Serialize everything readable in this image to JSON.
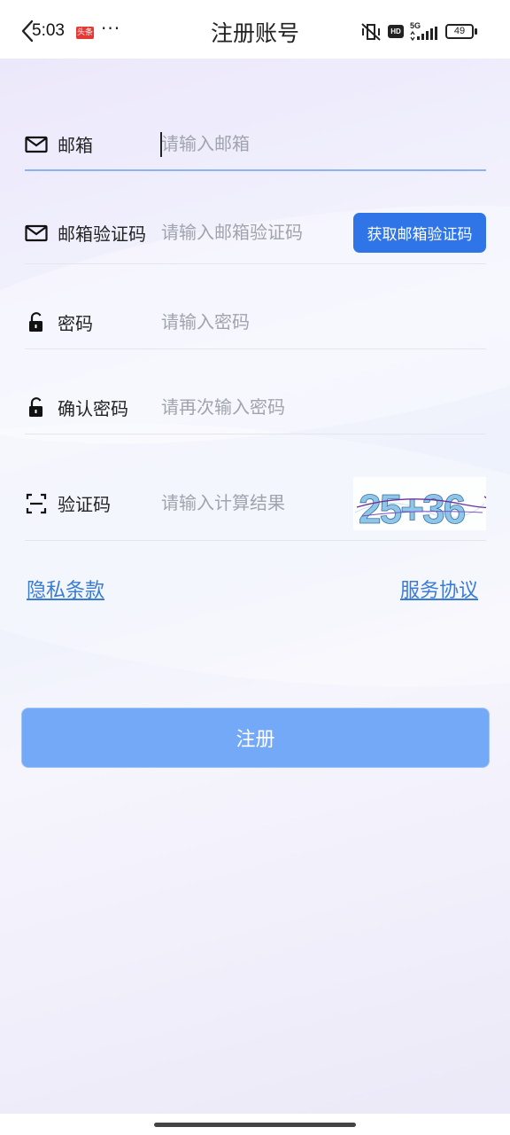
{
  "status_bar": {
    "time": "5:03",
    "app_badge": "头条",
    "more": "···",
    "network": "5G",
    "hd": "HD",
    "battery": "49"
  },
  "header": {
    "title": "注册账号"
  },
  "form": {
    "email": {
      "label": "邮箱",
      "placeholder": "请输入邮箱"
    },
    "email_code": {
      "label": "邮箱验证码",
      "placeholder": "请输入邮箱验证码",
      "button": "获取邮箱验证码"
    },
    "password": {
      "label": "密码",
      "placeholder": "请输入密码"
    },
    "confirm_password": {
      "label": "确认密码",
      "placeholder": "请再次输入密码"
    },
    "captcha": {
      "label": "验证码",
      "placeholder": "请输入计算结果",
      "image_text": "25+36"
    }
  },
  "links": {
    "privacy": "隐私条款",
    "service": "服务协议"
  },
  "register_button": "注册",
  "colors": {
    "primary": "#2f75e8",
    "register_disabled": "#74a9f7",
    "link": "#3a7bd5"
  }
}
